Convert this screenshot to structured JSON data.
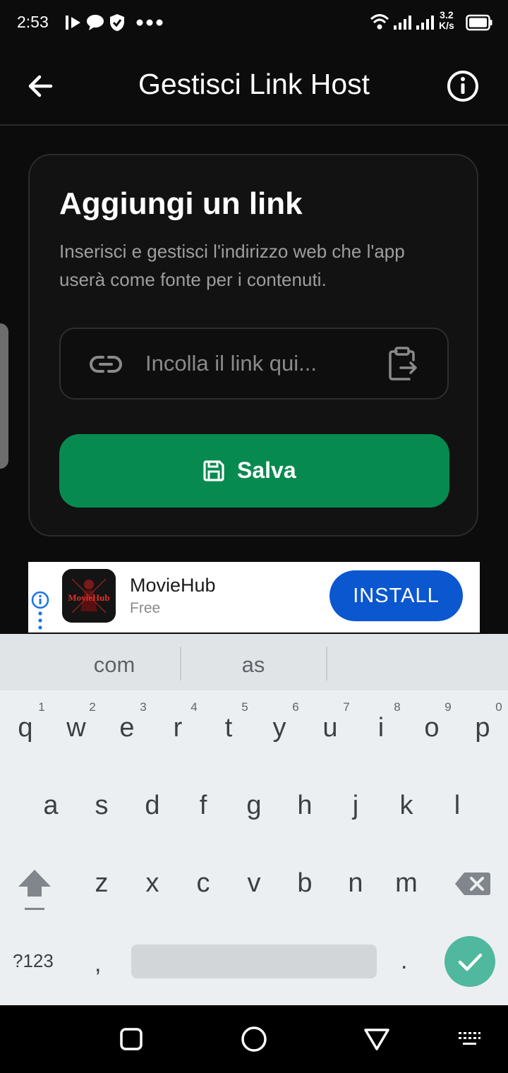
{
  "status_bar": {
    "time": "2:53",
    "net_speed_value": "3.2",
    "net_speed_unit": "K/s"
  },
  "app_bar": {
    "title": "Gestisci Link Host"
  },
  "card": {
    "title": "Aggiungi un link",
    "description": "Inserisci e gestisci l'indirizzo web che l'app userà come fonte per i contenuti.",
    "input_placeholder": "Incolla il link qui...",
    "save_label": "Salva"
  },
  "ad": {
    "app_name": "MovieHub",
    "price": "Free",
    "logo_text": "MovieHub",
    "cta": "INSTALL"
  },
  "keyboard": {
    "suggestions": [
      "com",
      "as"
    ],
    "row1": [
      {
        "k": "q",
        "h": "1"
      },
      {
        "k": "w",
        "h": "2"
      },
      {
        "k": "e",
        "h": "3"
      },
      {
        "k": "r",
        "h": "4"
      },
      {
        "k": "t",
        "h": "5"
      },
      {
        "k": "y",
        "h": "6"
      },
      {
        "k": "u",
        "h": "7"
      },
      {
        "k": "i",
        "h": "8"
      },
      {
        "k": "o",
        "h": "9"
      },
      {
        "k": "p",
        "h": "0"
      }
    ],
    "row2": [
      "a",
      "s",
      "d",
      "f",
      "g",
      "h",
      "j",
      "k",
      "l"
    ],
    "row3": [
      "z",
      "x",
      "c",
      "v",
      "b",
      "n",
      "m"
    ],
    "symbols_key": "?123",
    "comma_key": ",",
    "period_key": "."
  },
  "colors": {
    "accent_green": "#078a4f",
    "install_blue": "#0b57d0",
    "enter_key": "#4fb89e"
  }
}
